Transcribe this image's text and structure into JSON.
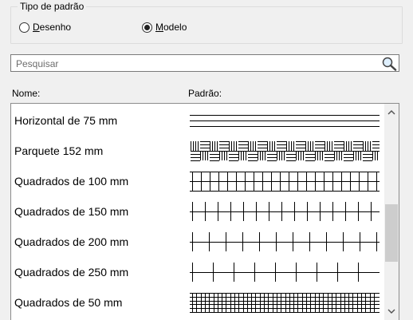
{
  "pattern_type": {
    "title": "Tipo de padrão",
    "options": [
      {
        "label": "Desenho",
        "checked": false
      },
      {
        "label": "Modelo",
        "checked": true
      }
    ]
  },
  "search": {
    "placeholder": "Pesquisar",
    "value": "",
    "icon": "magnifier-icon"
  },
  "columns": {
    "name": "Nome:",
    "pattern": "Padrão:"
  },
  "patterns": [
    {
      "name": "Horizontal de 75 mm",
      "preview": "horizontal-lines"
    },
    {
      "name": "Parquete 152 mm",
      "preview": "parquet"
    },
    {
      "name": "Quadrados de 100 mm",
      "preview": "grid-100"
    },
    {
      "name": "Quadrados de 150 mm",
      "preview": "grid-150"
    },
    {
      "name": "Quadrados de 200 mm",
      "preview": "grid-200"
    },
    {
      "name": "Quadrados de 250 mm",
      "preview": "grid-250"
    },
    {
      "name": "Quadrados de 50 mm",
      "preview": "grid-50"
    }
  ],
  "scrollbar": {
    "up_icon": "chevron-up-icon",
    "down_icon": "chevron-down-icon"
  }
}
